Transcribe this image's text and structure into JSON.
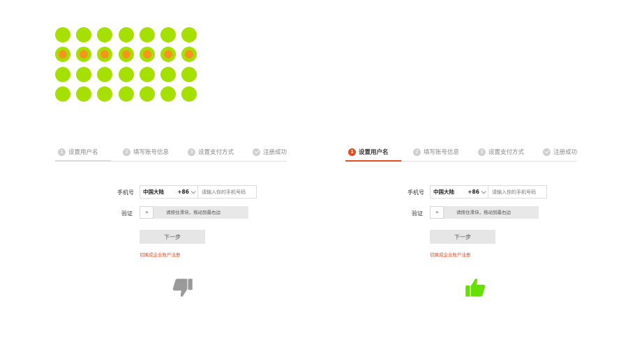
{
  "colors": {
    "dot_fill": "#a6e000",
    "dot_core": "#f7941d",
    "accent": "#e8491d",
    "inactive": "#cfcfcf",
    "thumbs_down": "#9a9a9a",
    "thumbs_up": "#66e000"
  },
  "dot_grid": {
    "rows": 4,
    "cols": 7,
    "highlighted_row": 2
  },
  "panels": [
    {
      "variant": "bad",
      "steps": [
        {
          "num": "1",
          "label": "设置用户名"
        },
        {
          "num": "2",
          "label": "填写账号信息"
        },
        {
          "num": "3",
          "label": "设置支付方式"
        },
        {
          "num": "",
          "label": "注册成功"
        }
      ],
      "phone_label": "手机号",
      "region": "中国大陆",
      "region_code": "+86",
      "phone_placeholder": "请输入你的手机号码",
      "verify_label": "验证",
      "slider_handle": "»",
      "slider_hint": "请按住滑块，拖动到最右边",
      "next_button": "下一步",
      "switch_link": "切换成企业账户注册",
      "feedback_icon": "thumbs-down-icon"
    },
    {
      "variant": "good",
      "steps": [
        {
          "num": "1",
          "label": "设置用户名"
        },
        {
          "num": "2",
          "label": "填写账号信息"
        },
        {
          "num": "3",
          "label": "设置支付方式"
        },
        {
          "num": "",
          "label": "注册成功"
        }
      ],
      "phone_label": "手机号",
      "region": "中国大陆",
      "region_code": "+86",
      "phone_placeholder": "请输入你的手机号码",
      "verify_label": "验证",
      "slider_handle": "»",
      "slider_hint": "请按住滑块，拖动到最右边",
      "next_button": "下一步",
      "switch_link": "切换成企业账户注册",
      "feedback_icon": "thumbs-up-icon"
    }
  ]
}
